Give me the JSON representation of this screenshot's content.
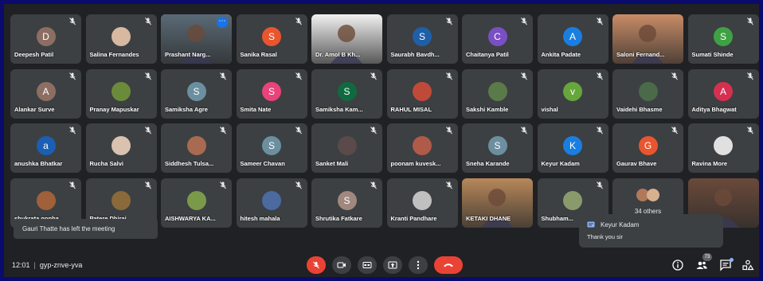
{
  "meeting": {
    "time": "12:01",
    "code": "gyp-znve-yva"
  },
  "rows": [
    [
      {
        "name": "Deepesh Patil",
        "initial": "D",
        "color": "#8d6e63",
        "kind": "letter"
      },
      {
        "name": "Salina Fernandes",
        "initial": "",
        "color": "#d7b8a0",
        "kind": "photo"
      },
      {
        "name": "Prashant Narg...",
        "initial": "",
        "color": "#5a6a76",
        "kind": "video",
        "active": true
      },
      {
        "name": "Sanika Rasal",
        "initial": "S",
        "color": "#e8552f",
        "kind": "letter"
      },
      {
        "name": "Dr. Amol B Kh...",
        "initial": "",
        "color": "#f1f1f1",
        "kind": "video"
      },
      {
        "name": "Saurabh Bavdh...",
        "initial": "S",
        "color": "#1f5fa8",
        "kind": "letter"
      },
      {
        "name": "Chaitanya Patil",
        "initial": "C",
        "color": "#7b4fc4",
        "kind": "letter"
      },
      {
        "name": "Ankita Padate",
        "initial": "A",
        "color": "#1a7ee0",
        "kind": "letter"
      },
      {
        "name": "Saloni Fernand...",
        "initial": "",
        "color": "#c98c66",
        "kind": "video"
      },
      {
        "name": "Sumati Shinde",
        "initial": "S",
        "color": "#3fa144",
        "kind": "letter"
      }
    ],
    [
      {
        "name": "Alankar Surve",
        "initial": "A",
        "color": "#8d6e63",
        "kind": "letter"
      },
      {
        "name": "Pranay Mapuskar",
        "initial": "",
        "color": "#6b8b3a",
        "kind": "photo"
      },
      {
        "name": "Samiksha Agre",
        "initial": "S",
        "color": "#6c8fa0",
        "kind": "letter"
      },
      {
        "name": "Smita Nate",
        "initial": "S",
        "color": "#e8437a",
        "kind": "letter"
      },
      {
        "name": "Samiksha Kam...",
        "initial": "S",
        "color": "#0f6b3f",
        "kind": "letter"
      },
      {
        "name": "RAHUL MISAL",
        "initial": "",
        "color": "#c04a3a",
        "kind": "photo"
      },
      {
        "name": "Sakshi Kamble",
        "initial": "",
        "color": "#5b7a4a",
        "kind": "photo"
      },
      {
        "name": "vishal",
        "initial": "v",
        "color": "#66a63b",
        "kind": "letter"
      },
      {
        "name": "Vaidehi Bhasme",
        "initial": "",
        "color": "#4a6a4a",
        "kind": "photo"
      },
      {
        "name": "Aditya Bhagwat",
        "initial": "A",
        "color": "#d62f50",
        "kind": "letter"
      }
    ],
    [
      {
        "name": "anushka Bhatkar",
        "initial": "a",
        "color": "#1a5fb4",
        "kind": "letter"
      },
      {
        "name": "Rucha Salvi",
        "initial": "",
        "color": "#d9c2b0",
        "kind": "photo"
      },
      {
        "name": "Siddhesh Tulsa...",
        "initial": "",
        "color": "#a86a50",
        "kind": "photo"
      },
      {
        "name": "Sameer Chavan",
        "initial": "S",
        "color": "#6c8fa0",
        "kind": "letter"
      },
      {
        "name": "Sanket Mali",
        "initial": "",
        "color": "#5a4a4a",
        "kind": "photo"
      },
      {
        "name": "poonam kuvesk...",
        "initial": "",
        "color": "#b05a4a",
        "kind": "photo"
      },
      {
        "name": "Sneha Karande",
        "initial": "S",
        "color": "#6c8fa0",
        "kind": "letter"
      },
      {
        "name": "Keyur Kadam",
        "initial": "K",
        "color": "#1a7ee0",
        "kind": "letter"
      },
      {
        "name": "Gaurav Bhave",
        "initial": "G",
        "color": "#e8552f",
        "kind": "letter"
      },
      {
        "name": "Ravina More",
        "initial": "",
        "color": "#e0e0e0",
        "kind": "photo"
      }
    ],
    [
      {
        "name": "shukrata gopha...",
        "initial": "",
        "color": "#a0603a",
        "kind": "photo"
      },
      {
        "name": "Patere Dhiraj",
        "initial": "",
        "color": "#8a6a3a",
        "kind": "photo"
      },
      {
        "name": "AISHWARYA KA...",
        "initial": "",
        "color": "#7a9a4a",
        "kind": "photo"
      },
      {
        "name": "hitesh mahala",
        "initial": "",
        "color": "#4a6aa0",
        "kind": "photo"
      },
      {
        "name": "Shrutika Fatkare",
        "initial": "S",
        "color": "#a1887f",
        "kind": "letter"
      },
      {
        "name": "Kranti Pandhare",
        "initial": "",
        "color": "#c0c0c0",
        "kind": "photo"
      },
      {
        "name": "KETAKI DHANE",
        "initial": "",
        "color": "#b8885a",
        "kind": "video"
      },
      {
        "name": "Shubham...",
        "initial": "",
        "color": "#8a9a6a",
        "kind": "photo"
      },
      {
        "name": "",
        "initial": "",
        "color": "",
        "kind": "others"
      },
      {
        "name": "",
        "initial": "",
        "color": "#6a4a3a",
        "kind": "video"
      }
    ]
  ],
  "others": {
    "label": "34 others"
  },
  "toast": {
    "text": "Gauri Thatte has left the meeting"
  },
  "chat_popup": {
    "sender": "Keyur Kadam",
    "message": "Thank you sir"
  },
  "participants_count": "73",
  "colors": {
    "background": "#202124",
    "tile": "#3c4043",
    "end_call": "#ea4335",
    "muted": "#ea4335",
    "accent": "#8ab4f8",
    "border": "#0b0b6e"
  },
  "icons": [
    "mic-off-icon",
    "camera-icon",
    "captions-icon",
    "present-icon",
    "more-icon",
    "end-call-icon",
    "info-icon",
    "people-icon",
    "chat-icon",
    "activities-icon"
  ]
}
